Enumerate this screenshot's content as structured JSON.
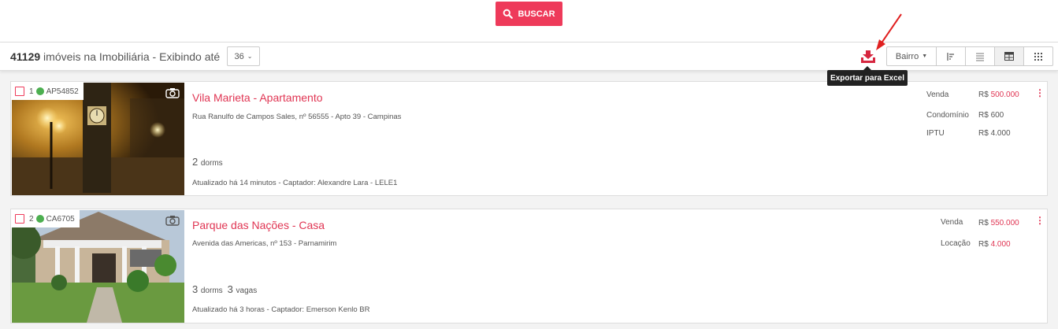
{
  "search": {
    "button_label": "BUSCAR"
  },
  "results": {
    "count": "41129",
    "count_suffix": " imóveis na Imobiliária - Exibindo até",
    "per_page": "36"
  },
  "toolbar": {
    "tooltip": "Exportar para Excel",
    "sort_label": "Bairro"
  },
  "listings": [
    {
      "index": "1",
      "code": "AP54852",
      "title": "Vila Marieta - Apartamento",
      "address": "Rua Ranulfo de Campos Sales, nº 56555 - Apto 39 - Campinas",
      "dorms": "2",
      "dorms_label": "dorms",
      "updated": "Atualizado há 14 minutos - Captador: Alexandre Lara - LELE1",
      "prices": [
        {
          "label": "Venda",
          "currency": "R$ ",
          "value": "500.000",
          "highlight": true
        },
        {
          "label": "Condomínio",
          "currency": "R$ ",
          "value": "600",
          "highlight": false
        },
        {
          "label": "IPTU",
          "currency": "R$ ",
          "value": "4.000",
          "highlight": false
        }
      ]
    },
    {
      "index": "2",
      "code": "CA6705",
      "title": "Parque das Nações - Casa",
      "address": "Avenida das Americas, nº 153 - Parnamirim",
      "dorms": "3",
      "dorms_label": "dorms",
      "vagas": "3",
      "vagas_label": "vagas",
      "updated": "Atualizado há 3 horas - Captador: Emerson Kenlo BR",
      "prices": [
        {
          "label": "Venda",
          "currency": "R$ ",
          "value": "550.000",
          "highlight": true
        },
        {
          "label": "Locação",
          "currency": "R$ ",
          "value": "4.000",
          "highlight": true
        }
      ]
    }
  ],
  "colors": {
    "accent": "#ee3a5a",
    "status_green": "#4caf50"
  }
}
